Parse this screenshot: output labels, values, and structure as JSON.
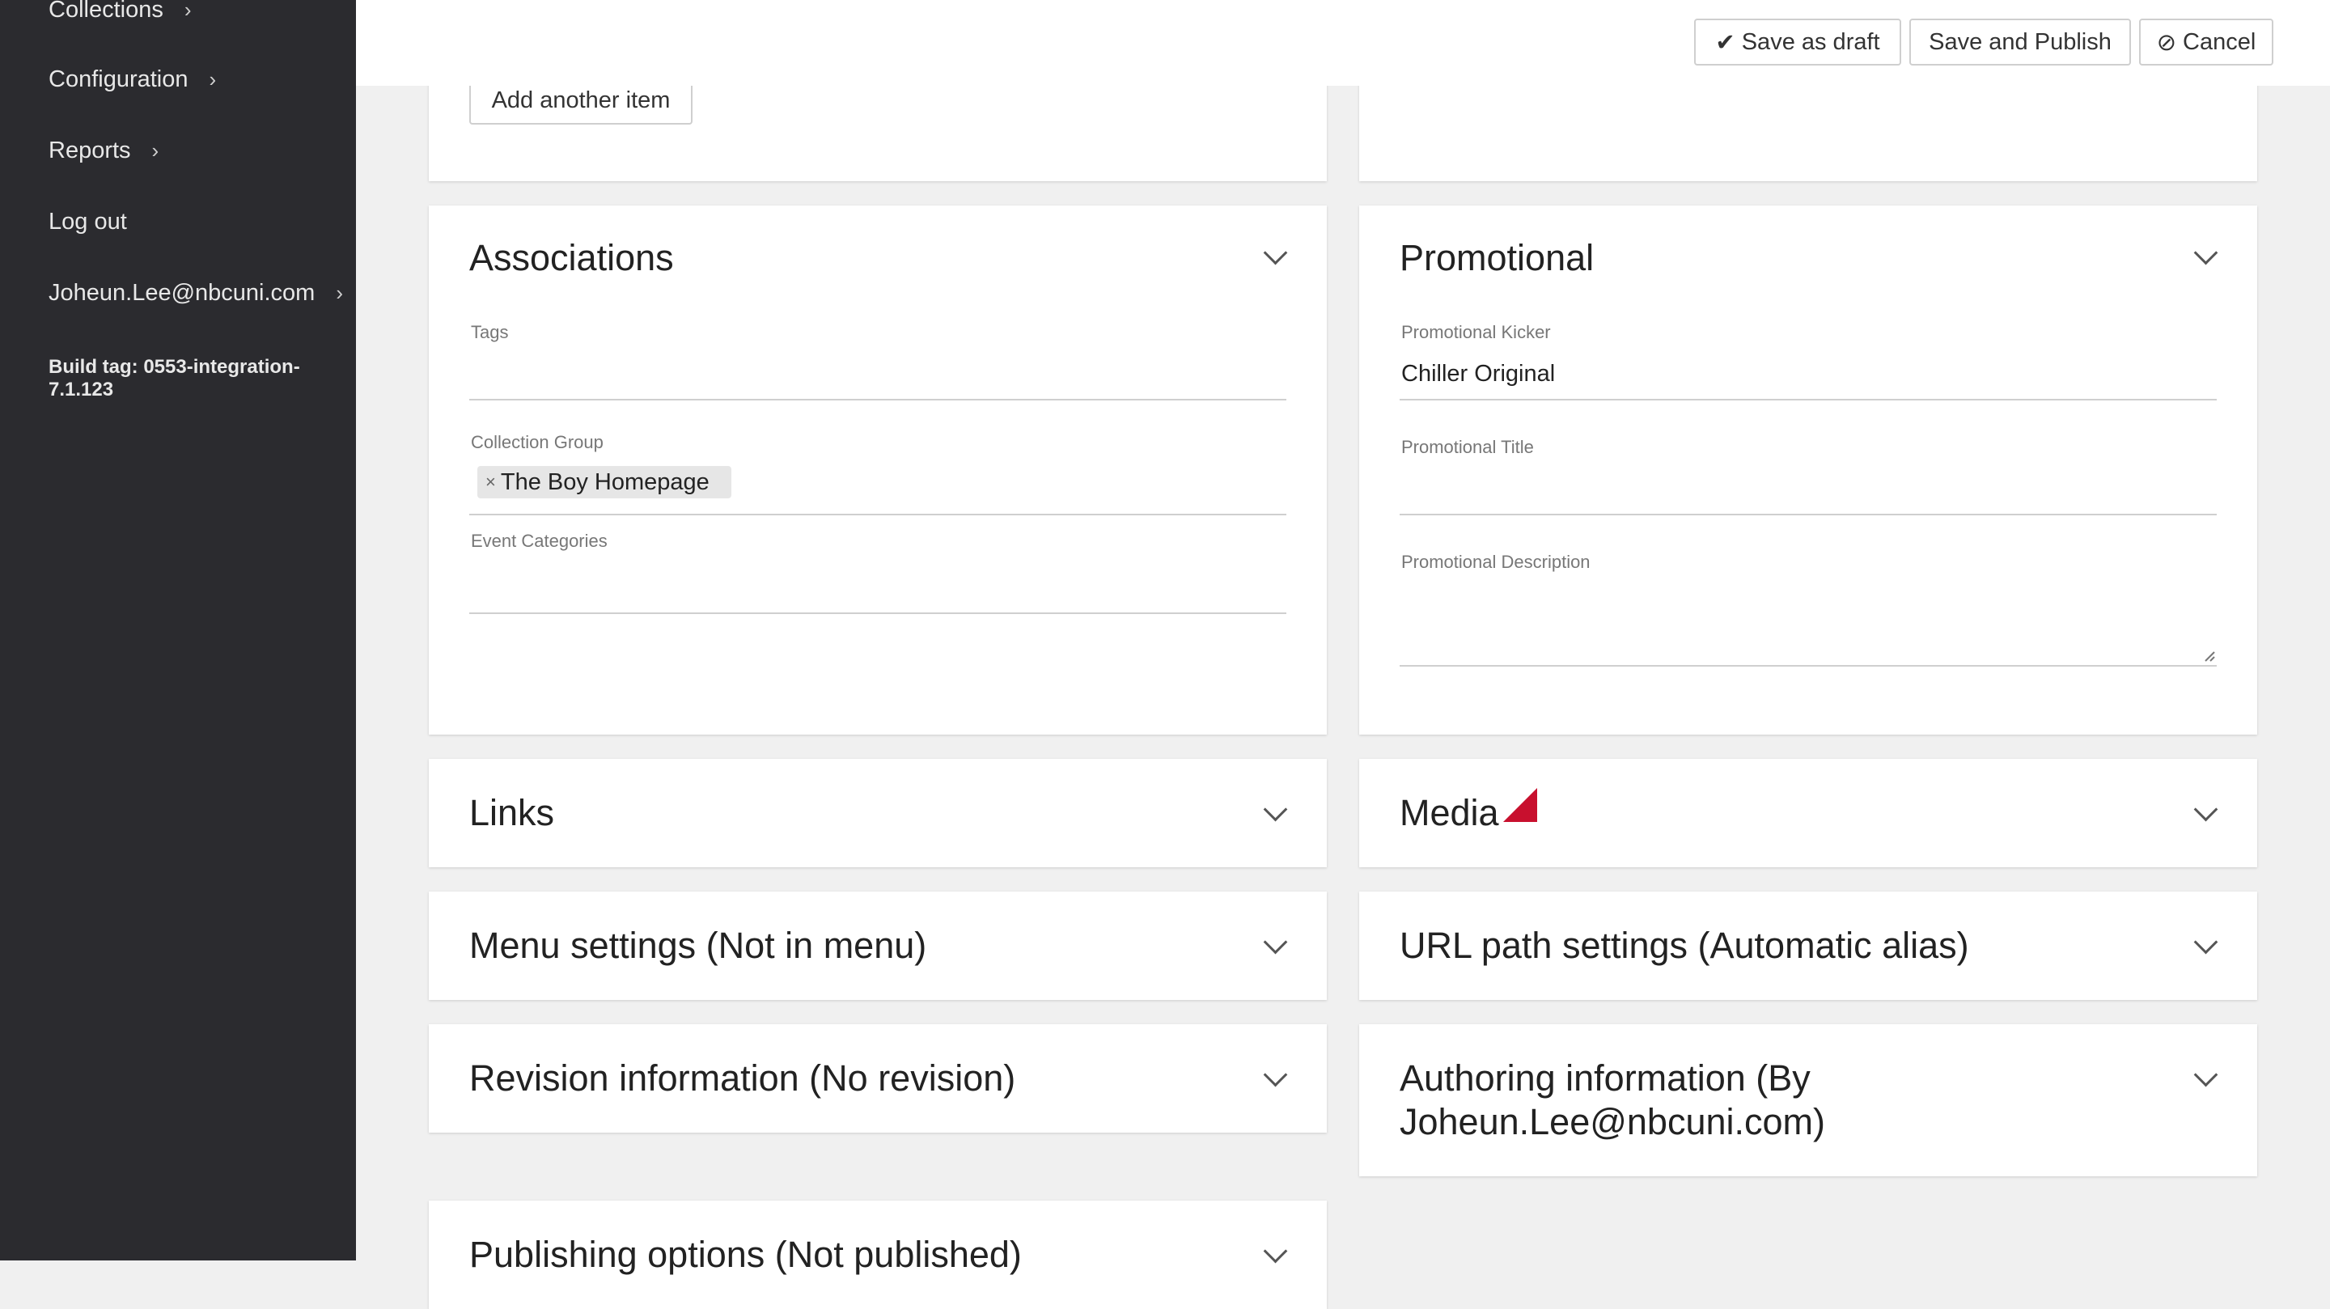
{
  "sidebar": {
    "items": [
      {
        "label": "Collections"
      },
      {
        "label": "Configuration"
      },
      {
        "label": "Reports"
      },
      {
        "label": "Log out"
      },
      {
        "label": "Joheun.Lee@nbcuni.com"
      }
    ],
    "build_tag": "Build tag: 0553-integration-7.1.123"
  },
  "toolbar": {
    "save_draft": "Save as draft",
    "save_publish": "Save and Publish",
    "cancel": "Cancel"
  },
  "top_panel": {
    "add_item": "Add another item"
  },
  "associations": {
    "title": "Associations",
    "tags_label": "Tags",
    "collection_group_label": "Collection Group",
    "collection_group_value": "The Boy Homepage",
    "event_categories_label": "Event Categories"
  },
  "promotional": {
    "title": "Promotional",
    "kicker_label": "Promotional Kicker",
    "kicker_value": "Chiller Original",
    "title_label": "Promotional Title",
    "description_label": "Promotional Description"
  },
  "sections": {
    "links": "Links",
    "media": "Media",
    "menu": "Menu settings (Not in menu)",
    "url": "URL path settings (Automatic alias)",
    "revision": "Revision information (No revision)",
    "authoring_line1": "Authoring information (By",
    "authoring_line2": "Joheun.Lee@nbcuni.com)",
    "publishing": "Publishing options (Not published)"
  },
  "colors": {
    "sidebar_bg": "#2b2b2f",
    "media_flag": "#c8102e"
  }
}
